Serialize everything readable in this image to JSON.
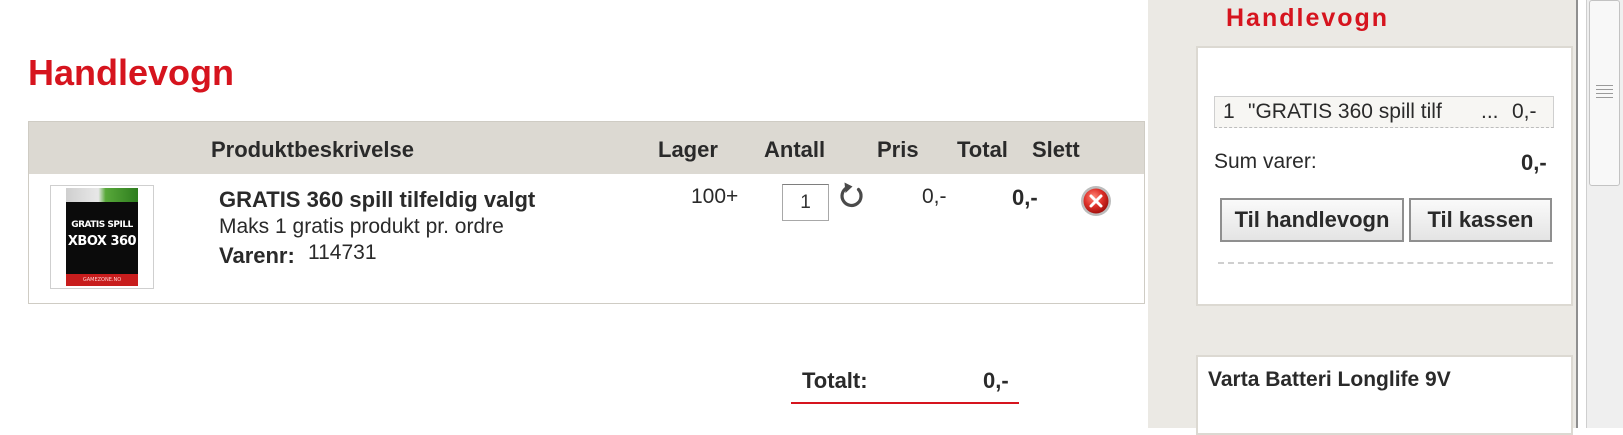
{
  "page": {
    "title": "Handlevogn"
  },
  "cart_table": {
    "headers": {
      "description": "Produktbeskrivelse",
      "stock": "Lager",
      "quantity": "Antall",
      "price": "Pris",
      "total": "Total",
      "delete": "Slett"
    },
    "items": [
      {
        "image_text_line1": "GRATIS SPILL",
        "image_text_line2": "XBOX 360",
        "image_footer": "GAMEZONE.NO",
        "name": "GRATIS 360 spill tilfeldig valgt",
        "description": "Maks 1 gratis produkt pr. ordre",
        "varenr_label": "Varenr:",
        "varenr": "114731",
        "stock": "100+",
        "quantity": "1",
        "price": "0,-",
        "total": "0,-"
      }
    ],
    "grand_total_label": "Totalt:",
    "grand_total_value": "0,-"
  },
  "sidebar": {
    "title": "Handlevogn",
    "mini_cart_line": {
      "qty": "1",
      "name": "\"GRATIS 360 spill tilf",
      "ellipsis": "...",
      "price": "0,-"
    },
    "sum_label": "Sum varer:",
    "sum_value": "0,-",
    "button_cart": "Til handlevogn",
    "button_checkout": "Til kassen",
    "promo_title": "Varta Batteri Longlife 9V"
  },
  "colors": {
    "accent": "#d6141e",
    "header_bg": "#dcd9d2",
    "sidebar_bg": "#ebe9e4"
  },
  "icons": {
    "refresh": "refresh-icon",
    "delete": "delete-icon"
  }
}
